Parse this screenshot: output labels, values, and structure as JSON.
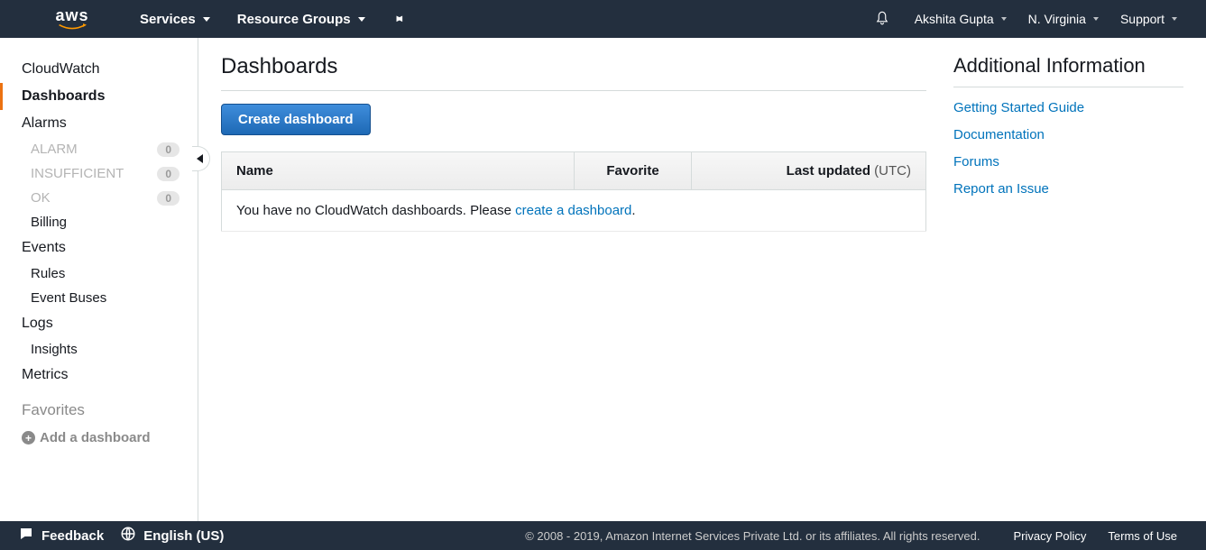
{
  "nav": {
    "logo_text": "aws",
    "services": "Services",
    "resource_groups": "Resource Groups",
    "user": "Akshita Gupta",
    "region": "N. Virginia",
    "support": "Support"
  },
  "sidebar": {
    "cloudwatch": "CloudWatch",
    "dashboards": "Dashboards",
    "alarms": "Alarms",
    "alarm_state": {
      "label": "ALARM",
      "count": "0"
    },
    "insufficient": {
      "label": "INSUFFICIENT",
      "count": "0"
    },
    "ok": {
      "label": "OK",
      "count": "0"
    },
    "billing": "Billing",
    "events": "Events",
    "rules": "Rules",
    "event_buses": "Event Buses",
    "logs": "Logs",
    "insights": "Insights",
    "metrics": "Metrics",
    "favorites": "Favorites",
    "add_dashboard": "Add a dashboard"
  },
  "main": {
    "title": "Dashboards",
    "create_btn": "Create dashboard",
    "table": {
      "col_name": "Name",
      "col_favorite": "Favorite",
      "col_updated": "Last updated",
      "col_updated_suffix": " (UTC)"
    },
    "empty_prefix": "You have no CloudWatch dashboards. Please ",
    "empty_link": "create a dashboard",
    "empty_suffix": "."
  },
  "info": {
    "title": "Additional Information",
    "links": {
      "guide": "Getting Started Guide",
      "docs": "Documentation",
      "forums": "Forums",
      "report": "Report an Issue"
    }
  },
  "footer": {
    "feedback": "Feedback",
    "language": "English (US)",
    "copyright": "© 2008 - 2019, Amazon Internet Services Private Ltd. or its affiliates. All rights reserved.",
    "privacy": "Privacy Policy",
    "terms": "Terms of Use"
  }
}
